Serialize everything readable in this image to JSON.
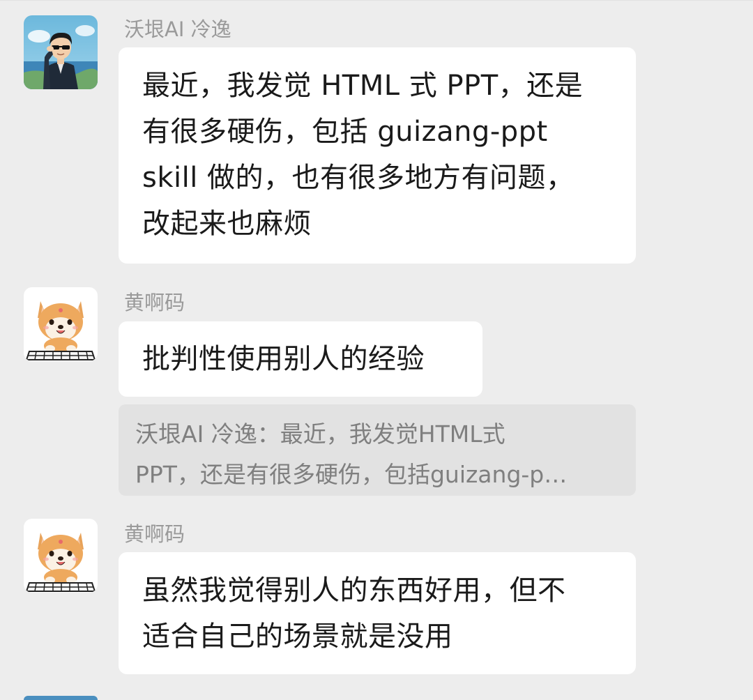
{
  "messages": [
    {
      "sender": "沃垠AI 冷逸",
      "avatar_icon": "man-sunglasses-avatar",
      "lines": [
        "最近，我发觉 HTML 式 PPT，还是",
        "有很多硬伤，包括 guizang-ppt",
        "skill 做的，也有很多地方有问题，",
        "改起来也麻烦"
      ]
    },
    {
      "sender": "黄啊码",
      "avatar_icon": "shiba-dog-keyboard-avatar",
      "lines": [
        "批判性使用别人的经验"
      ],
      "quote_lines": [
        "沃垠AI 冷逸：最近，我发觉HTML式",
        "PPT，还是有很多硬伤，包括guizang-p…"
      ]
    },
    {
      "sender": "黄啊码",
      "avatar_icon": "shiba-dog-keyboard-avatar",
      "lines": [
        "虽然我觉得别人的东西好用，但不",
        "适合自己的场景就是没用"
      ]
    }
  ],
  "colors": {
    "background": "#ededed",
    "bubble": "#ffffff",
    "quote": "#e2e2e2",
    "sender_text": "#9a9a9a",
    "message_text": "#1a1a1a"
  }
}
